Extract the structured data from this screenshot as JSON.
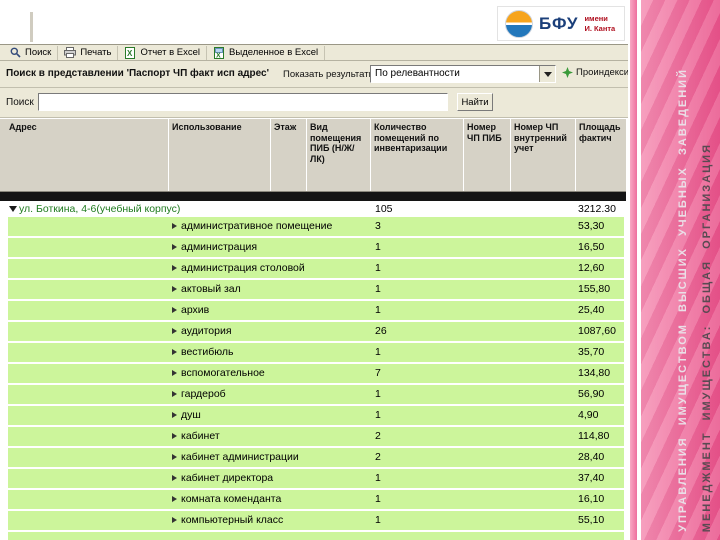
{
  "colors": {
    "row_green": "#ccf59b",
    "sidebar_pink": "#e9548b",
    "toolbar_gray": "#ece9d8"
  },
  "logo": {
    "abbr": "БФУ",
    "subtitle_line1": "имени",
    "subtitle_line2": "И. Канта"
  },
  "toolbar": {
    "buttons": [
      {
        "label": "Поиск",
        "icon": "search-icon"
      },
      {
        "label": "Печать",
        "icon": "print-icon"
      },
      {
        "label": "Отчет в Excel",
        "icon": "excel-report-icon"
      },
      {
        "label": "Выделенное в Excel",
        "icon": "excel-selection-icon"
      }
    ]
  },
  "search_panel": {
    "view_label": "Поиск в представлении 'Паспорт ЧП факт исп адрес'",
    "show_results_label": "Показать результаты:",
    "relevance_value": "По релевантности",
    "indexed_label": "Проиндексиров",
    "search_field_label": "Поиск",
    "search_field_value": "",
    "find_button_label": "Найти"
  },
  "table": {
    "columns": [
      "Адрес",
      "Использование",
      "Этаж",
      "Вид помещения ПИБ (Н/Ж/ЛК)",
      "Количество помещений по инвентаризации",
      "Номер ЧП ПИБ",
      "Номер ЧП внутренний учет",
      "Площадь фактич"
    ],
    "group_row": {
      "address": "ул. Боткина, 4-6(учебный корпус)",
      "count": "105",
      "area": "3212.30"
    },
    "rows": [
      {
        "usage": "административное помещение",
        "count": "3",
        "area": "53,30"
      },
      {
        "usage": "администрация",
        "count": "1",
        "area": "16,50"
      },
      {
        "usage": "администрация столовой",
        "count": "1",
        "area": "12,60"
      },
      {
        "usage": "актовый зал",
        "count": "1",
        "area": "155,80"
      },
      {
        "usage": "архив",
        "count": "1",
        "area": "25,40"
      },
      {
        "usage": "аудитория",
        "count": "26",
        "area": "1087,60"
      },
      {
        "usage": "вестибюль",
        "count": "1",
        "area": "35,70"
      },
      {
        "usage": "вспомогательное",
        "count": "7",
        "area": "134,80"
      },
      {
        "usage": "гардероб",
        "count": "1",
        "area": "56,90"
      },
      {
        "usage": "душ",
        "count": "1",
        "area": "4,90"
      },
      {
        "usage": "кабинет",
        "count": "2",
        "area": "114,80"
      },
      {
        "usage": "кабинет администрации",
        "count": "2",
        "area": "28,40"
      },
      {
        "usage": "кабинет директора",
        "count": "1",
        "area": "37,40"
      },
      {
        "usage": "комната коменданта",
        "count": "1",
        "area": "16,10"
      },
      {
        "usage": "компьютерный класс",
        "count": "1",
        "area": "55,10"
      }
    ]
  },
  "sidebar": {
    "title_primary": "МЕНЕДЖМЕНТ  ИМУЩЕСТВА:  ОБЩАЯ  ОРГАНИЗАЦИЯ",
    "title_secondary": "УПРАВЛЕНИЯ  ИМУЩЕСТВОМ  ВЫСШИХ  УЧЕБНЫХ  ЗАВЕДЕНИЙ"
  }
}
